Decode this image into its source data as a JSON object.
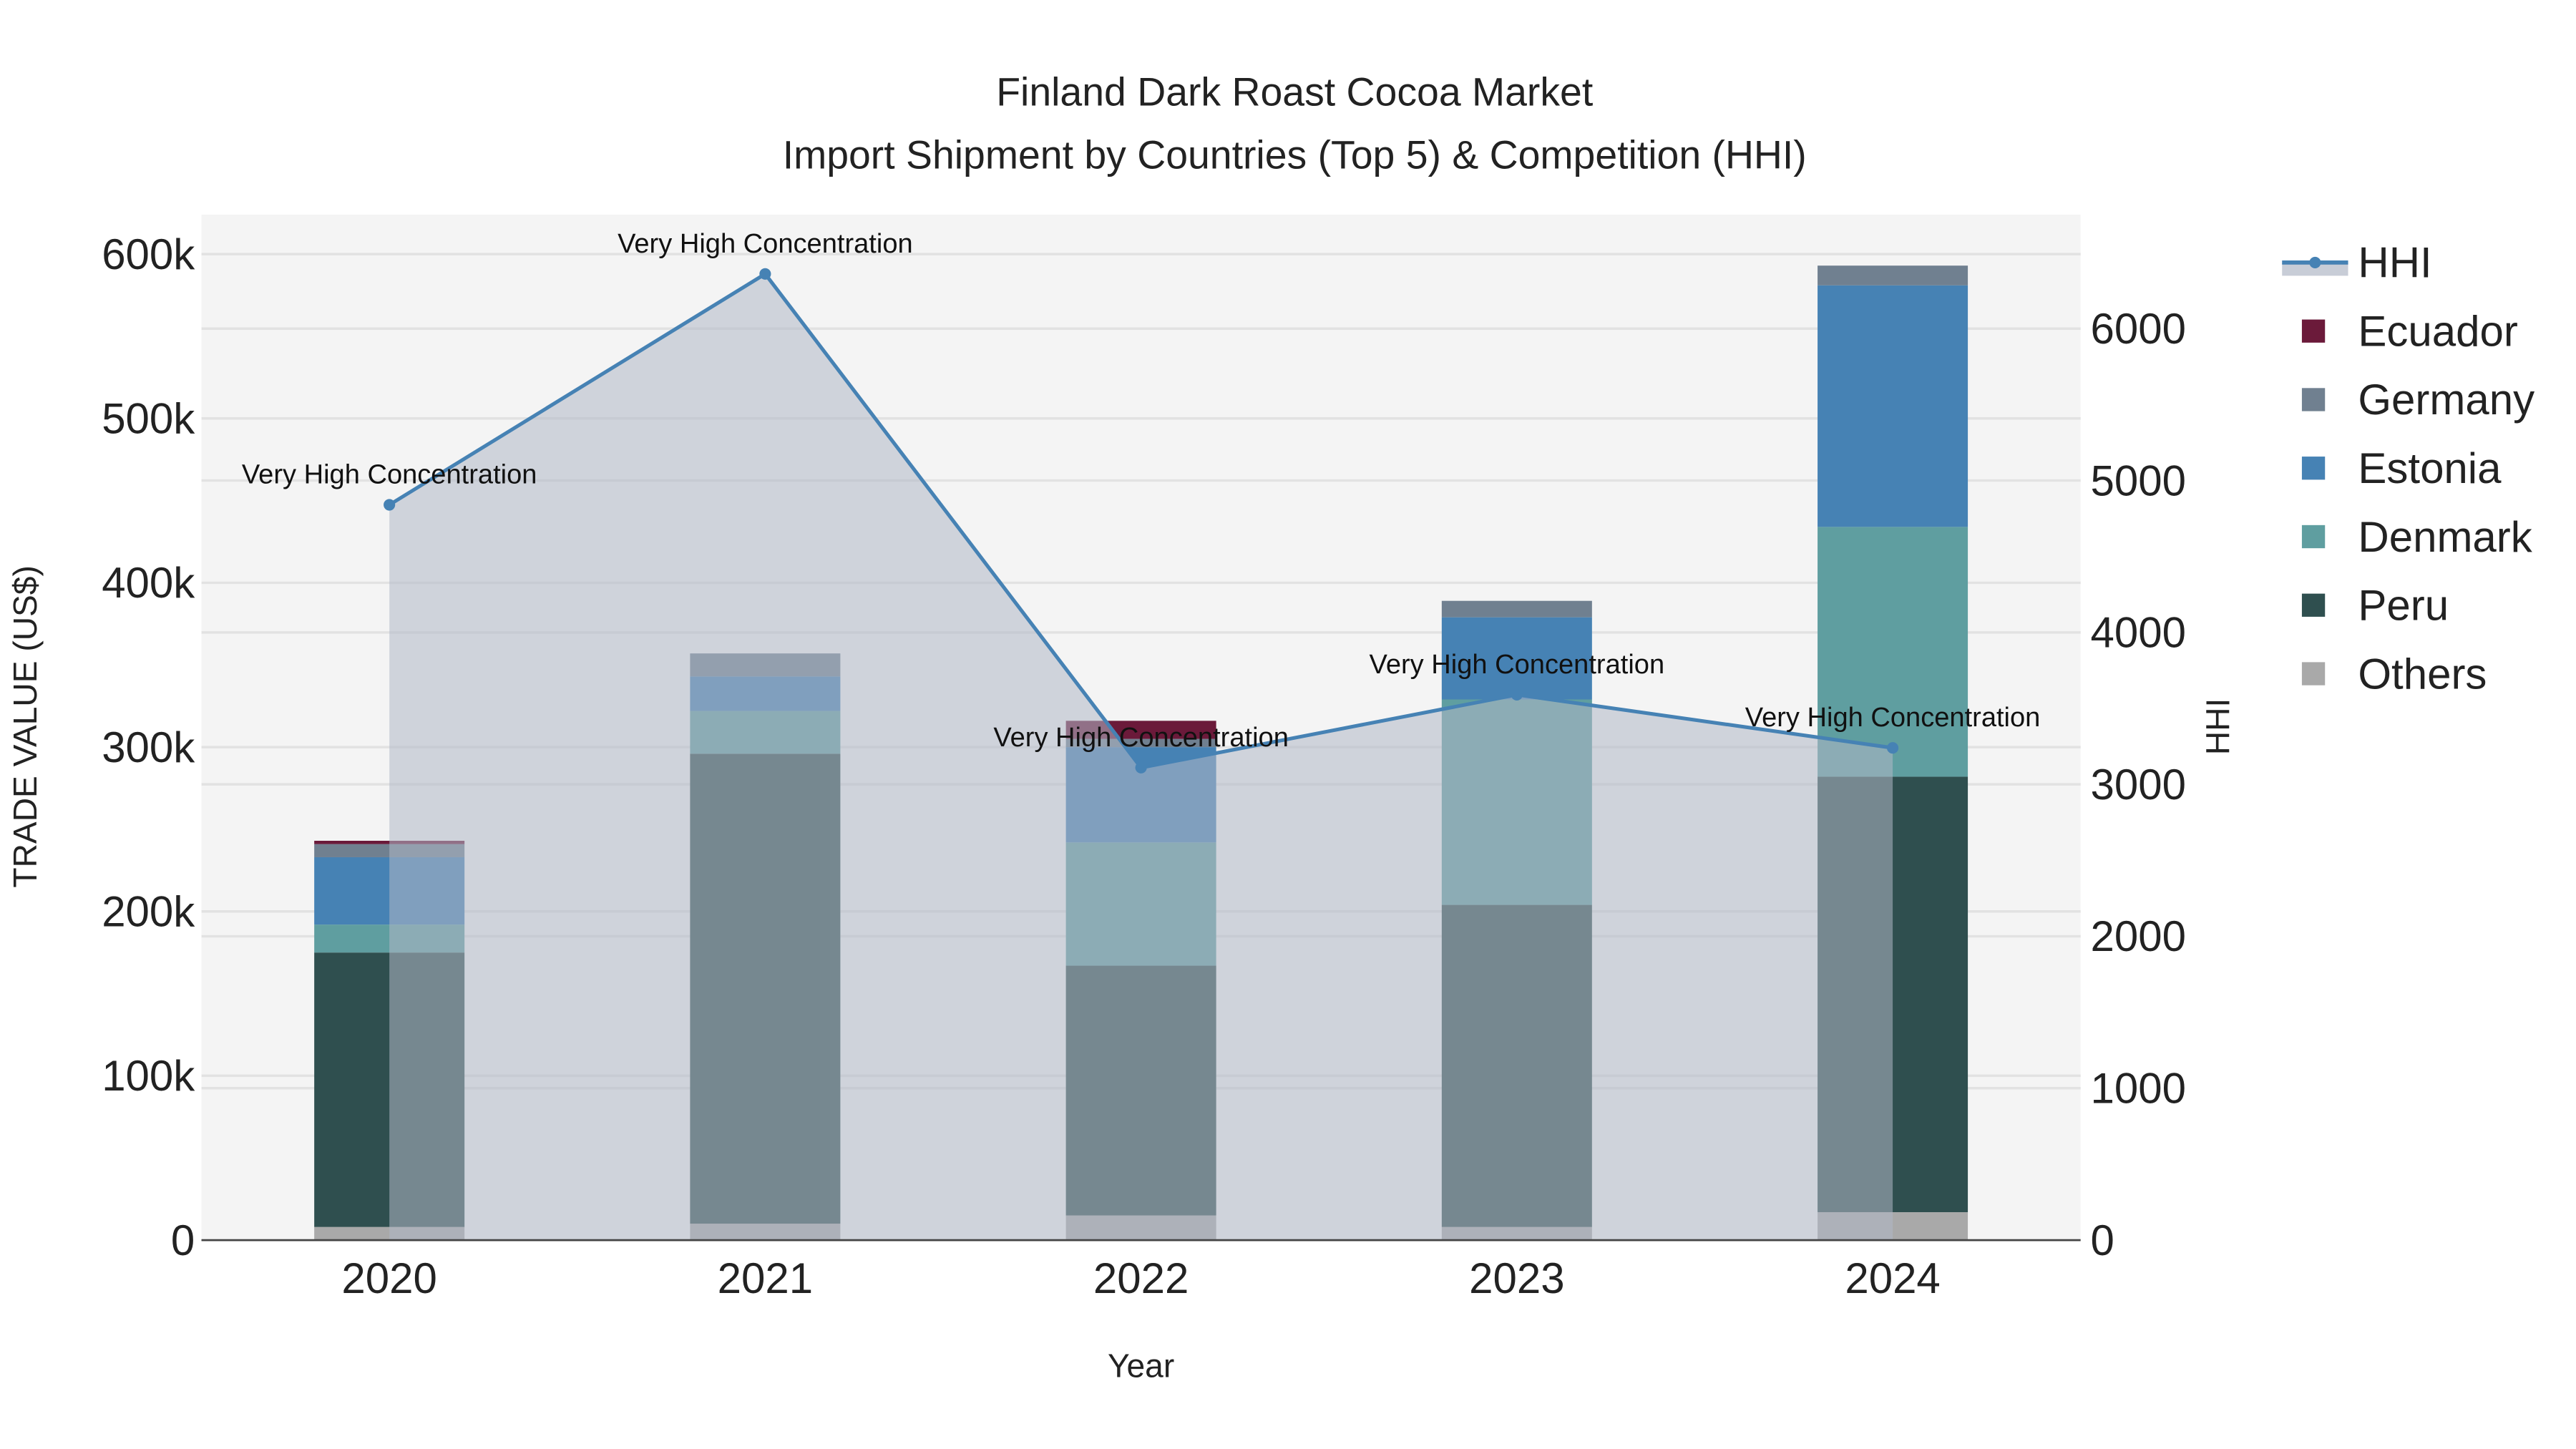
{
  "chart_data": {
    "type": "bar",
    "title": "Finland Dark Roast Cocoa Market",
    "subtitle": "Import Shipment by Countries (Top 5) & Competition (HHI)",
    "xlabel": "Year",
    "ylabel": "TRADE VALUE (US$)",
    "y2label": "HHI",
    "categories": [
      "2020",
      "2021",
      "2022",
      "2023",
      "2024"
    ],
    "ylim": [
      0,
      624000
    ],
    "y2lim": [
      0,
      6750
    ],
    "yticks": [
      0,
      100000,
      200000,
      300000,
      400000,
      500000,
      600000
    ],
    "ytick_labels": [
      "0",
      "100k",
      "200k",
      "300k",
      "400k",
      "500k",
      "600k"
    ],
    "y2ticks": [
      0,
      1000,
      2000,
      3000,
      4000,
      5000,
      6000
    ],
    "y2tick_labels": [
      "0",
      "1000",
      "2000",
      "3000",
      "4000",
      "5000",
      "6000"
    ],
    "stacked": true,
    "series": [
      {
        "name": "Others",
        "color": "#A9A9A9",
        "values": [
          8000,
          10000,
          15000,
          8000,
          17000
        ]
      },
      {
        "name": "Peru",
        "color": "#2F4F4F",
        "values": [
          167000,
          286000,
          152000,
          196000,
          265000
        ]
      },
      {
        "name": "Denmark",
        "color": "#5F9EA0",
        "values": [
          17000,
          26000,
          75000,
          125000,
          152000
        ]
      },
      {
        "name": "Estonia",
        "color": "#4682B4",
        "values": [
          41000,
          21000,
          58000,
          50000,
          147000
        ]
      },
      {
        "name": "Germany",
        "color": "#708090",
        "values": [
          8000,
          14000,
          5000,
          10000,
          12000
        ]
      },
      {
        "name": "Ecuador",
        "color": "#6B1A3A",
        "values": [
          2000,
          0,
          11000,
          0,
          0
        ]
      }
    ],
    "line": {
      "name": "HHI",
      "color": "#4682B4",
      "values": [
        4840,
        6360,
        3110,
        3590,
        3240
      ],
      "annotations": [
        "Very High Concentration",
        "Very High Concentration",
        "Very High Concentration",
        "Very High Concentration",
        "Very High Concentration"
      ]
    },
    "legend": [
      "HHI",
      "Ecuador",
      "Germany",
      "Estonia",
      "Denmark",
      "Peru",
      "Others"
    ],
    "legend_position": "right",
    "grid": true
  }
}
